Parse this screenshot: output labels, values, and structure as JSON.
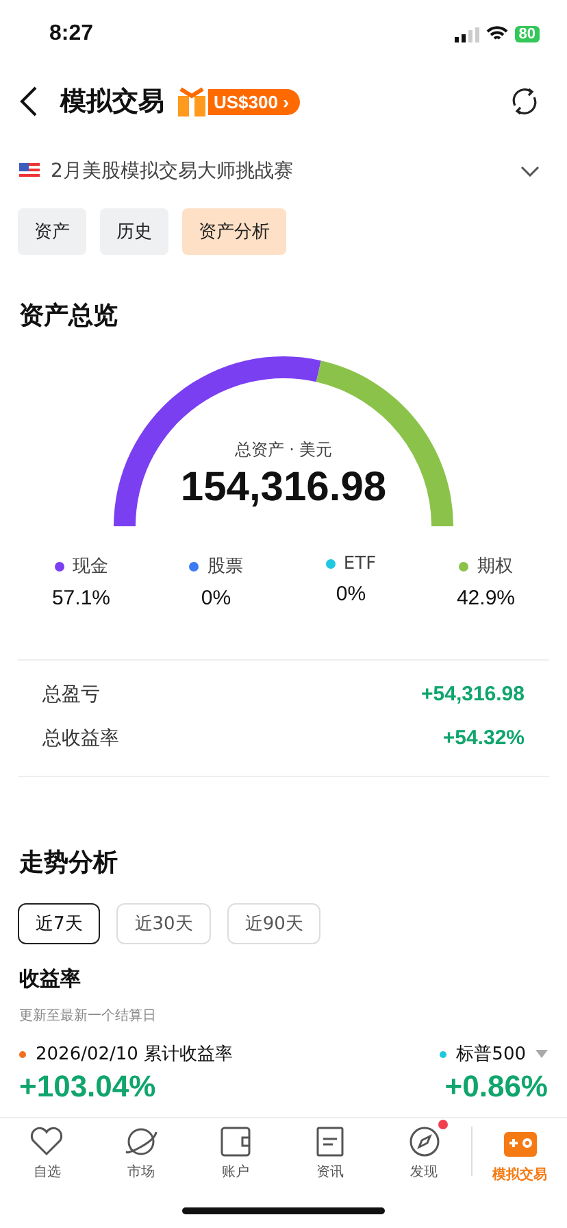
{
  "status_bar": {
    "time": "8:27",
    "battery": "80"
  },
  "header": {
    "title": "模拟交易",
    "promo": "US$300",
    "promo_arrow": "›"
  },
  "competition": {
    "name": "2月美股模拟交易大师挑战赛"
  },
  "tabs": [
    {
      "label": "资产",
      "selected": false
    },
    {
      "label": "历史",
      "selected": false
    },
    {
      "label": "资产分析",
      "selected": true
    }
  ],
  "overview": {
    "title": "资产总览",
    "caption": "总资产 · 美元",
    "total": "154,316.98",
    "chart_data": {
      "type": "donut",
      "categories": [
        "现金",
        "股票",
        "ETF",
        "期权"
      ],
      "values": [
        57.1,
        0,
        0,
        42.9
      ]
    },
    "legend": [
      {
        "value": "57.1%",
        "color": "#7b3ff2"
      },
      {
        "value": "0%",
        "color": "#3d7bf5"
      },
      {
        "value": "0%",
        "color": "#1ec8e0"
      },
      {
        "value": "42.9%",
        "color": "#8bc34a"
      }
    ],
    "stats": [
      {
        "label": "总盈亏",
        "value": "+54,316.98"
      },
      {
        "label": "总收益率",
        "value": "+54.32%"
      }
    ]
  },
  "trend": {
    "title": "走势分析",
    "periods": [
      {
        "label": "近7天",
        "selected": true
      },
      {
        "label": "近30天",
        "selected": false
      },
      {
        "label": "近90天",
        "selected": false
      }
    ],
    "subtitle": "收益率",
    "note": "更新至最新一个结算日",
    "left": {
      "label": "2026/02/10 累计收益率",
      "color": "#f07020",
      "value": "+103.04%"
    },
    "right": {
      "label": "标普500",
      "color": "#1ec8e0",
      "value": "+0.86%"
    }
  },
  "nav": [
    {
      "label": "自选",
      "kind": "heart",
      "selected": false,
      "dot": false
    },
    {
      "label": "市场",
      "kind": "planet",
      "selected": false,
      "dot": false
    },
    {
      "label": "账户",
      "kind": "wallet",
      "selected": false,
      "dot": false
    },
    {
      "label": "资讯",
      "kind": "doc",
      "selected": false,
      "dot": false
    },
    {
      "label": "发现",
      "kind": "compass",
      "selected": false,
      "dot": true
    },
    {
      "label": "模拟交易",
      "kind": "game",
      "selected": true,
      "dot": false
    }
  ]
}
